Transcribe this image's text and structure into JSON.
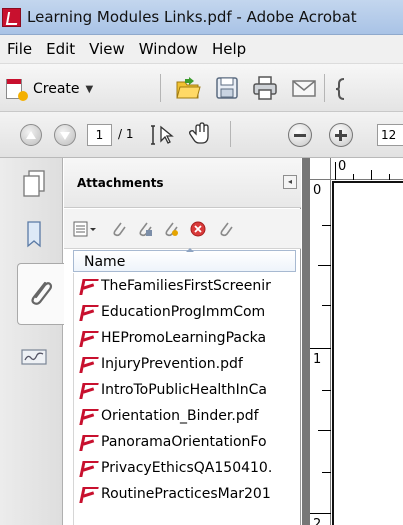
{
  "window": {
    "title": "Learning Modules Links.pdf - Adobe Acrobat"
  },
  "menu": {
    "items": [
      "File",
      "Edit",
      "View",
      "Window",
      "Help"
    ]
  },
  "toolbar": {
    "create_label": "Create",
    "icons": [
      "open-folder-icon",
      "save-icon",
      "print-icon",
      "email-icon"
    ]
  },
  "navigation": {
    "current_page": "1",
    "total_pages": "/ 1",
    "zoom": "12"
  },
  "attachments_panel": {
    "title": "Attachments",
    "column_header": "Name",
    "files": [
      "TheFamiliesFirstScreenir",
      "EducationProgImmCom",
      "HEPromoLearningPacka",
      "InjuryPrevention.pdf",
      "IntroToPublicHealthInCa",
      "Orientation_Binder.pdf",
      "PanoramaOrientationFo",
      "PrivacyEthicsQA150410.",
      "RoutinePracticesMar201"
    ]
  },
  "ruler": {
    "top_label": "0",
    "left_labels": [
      "0",
      "1",
      "2"
    ]
  }
}
